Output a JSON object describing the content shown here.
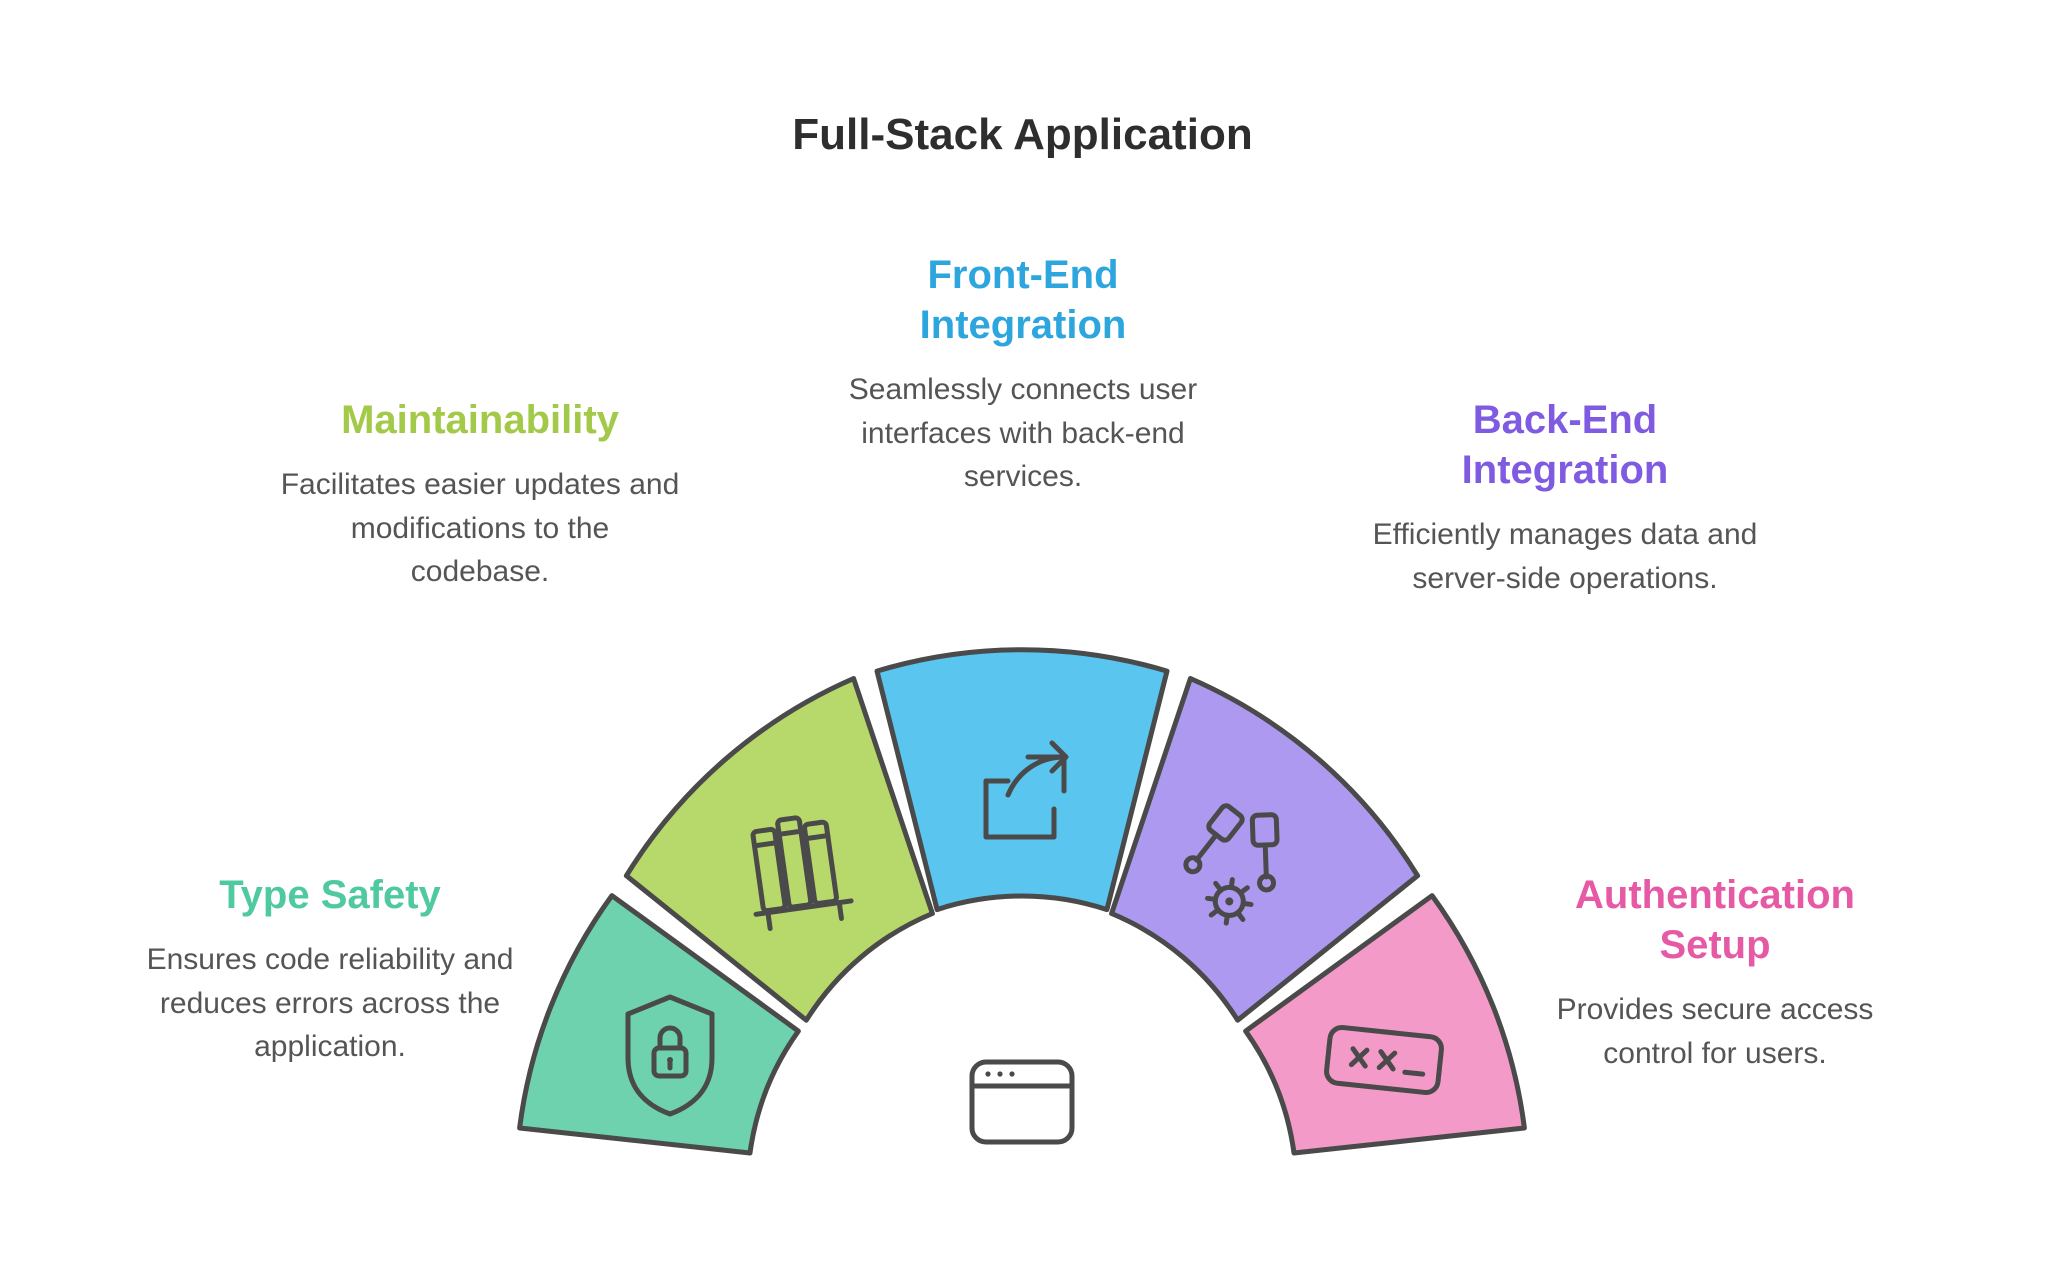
{
  "title": "Full-Stack Application",
  "center_icon": "app-window",
  "segments": [
    {
      "key": "type_safety",
      "title": "Type Safety",
      "description": "Ensures code reliability and reduces errors across the application.",
      "color_name": "green",
      "color": "#4FC9A0",
      "fill": "#6ED2AE",
      "icon": "shield-lock"
    },
    {
      "key": "maintainability",
      "title": "Maintainability",
      "description": "Facilitates easier updates and modifications to the codebase.",
      "color_name": "lime",
      "color": "#A3C948",
      "fill": "#B7D86A",
      "icon": "bookshelf"
    },
    {
      "key": "front_end_integration",
      "title": "Front-End Integration",
      "description": "Seamlessly connects user interfaces with back-end services.",
      "color_name": "blue",
      "color": "#2DA6DE",
      "fill": "#5AC5EE",
      "icon": "share-arrow"
    },
    {
      "key": "back_end_integration",
      "title": "Back-End Integration",
      "description": "Efficiently manages data and server-side operations.",
      "color_name": "purple",
      "color": "#7E5BE0",
      "fill": "#AD9AF0",
      "icon": "pistons-gear"
    },
    {
      "key": "authentication_setup",
      "title": "Authentication Setup",
      "description": "Provides secure access control for users.",
      "color_name": "pink",
      "color": "#E65AA5",
      "fill": "#F49AC9",
      "icon": "password-field"
    }
  ]
}
